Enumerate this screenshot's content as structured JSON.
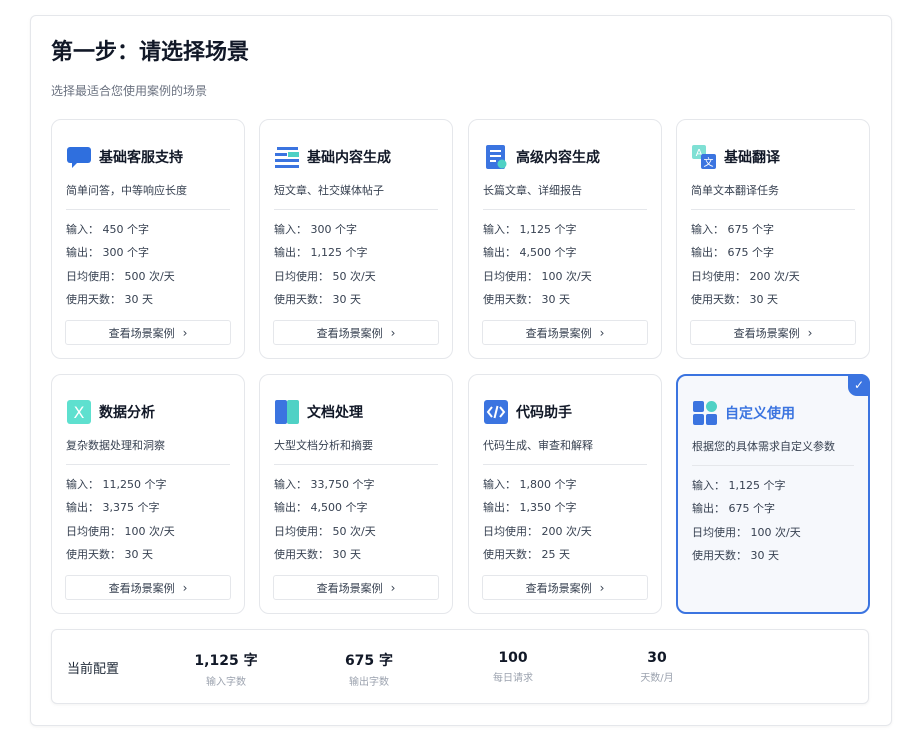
{
  "header": {
    "title": "第一步：请选择场景",
    "subtitle": "选择最适合您使用案例的场景"
  },
  "labels": {
    "input": "输入：",
    "output": "输出：",
    "daily": "日均使用：",
    "days": "使用天数：",
    "view_cases": "查看场景案例",
    "chevron": "›",
    "check": "✓"
  },
  "scenarios": [
    {
      "name": "基础客服支持",
      "icon": "chat-bubble-icon",
      "desc": "简单问答，中等响应长度",
      "input": "450 个字",
      "output": "300 个字",
      "daily": "500 次/天",
      "days": "30 天",
      "has_button": true,
      "selected": false
    },
    {
      "name": "基础内容生成",
      "icon": "text-lines-icon",
      "desc": "短文章、社交媒体帖子",
      "input": "300 个字",
      "output": "1,125 个字",
      "daily": "50 次/天",
      "days": "30 天",
      "has_button": true,
      "selected": false
    },
    {
      "name": "高级内容生成",
      "icon": "document-star-icon",
      "desc": "长篇文章、详细报告",
      "input": "1,125 个字",
      "output": "4,500 个字",
      "daily": "100 次/天",
      "days": "30 天",
      "has_button": true,
      "selected": false
    },
    {
      "name": "基础翻译",
      "icon": "translate-icon",
      "desc": "简单文本翻译任务",
      "input": "675 个字",
      "output": "675 个字",
      "daily": "200 次/天",
      "days": "30 天",
      "has_button": true,
      "selected": false
    },
    {
      "name": "数据分析",
      "icon": "excel-icon",
      "desc": "复杂数据处理和洞察",
      "input": "11,250 个字",
      "output": "3,375 个字",
      "daily": "100 次/天",
      "days": "30 天",
      "has_button": true,
      "selected": false
    },
    {
      "name": "文档处理",
      "icon": "book-icon",
      "desc": "大型文档分析和摘要",
      "input": "33,750 个字",
      "output": "4,500 个字",
      "daily": "50 次/天",
      "days": "30 天",
      "has_button": true,
      "selected": false
    },
    {
      "name": "代码助手",
      "icon": "code-icon",
      "desc": "代码生成、审查和解释",
      "input": "1,800 个字",
      "output": "1,350 个字",
      "daily": "200 次/天",
      "days": "25 天",
      "has_button": true,
      "selected": false
    },
    {
      "name": "自定义使用",
      "icon": "apps-grid-icon",
      "desc": "根据您的具体需求自定义参数",
      "input": "1,125 个字",
      "output": "675 个字",
      "daily": "100 次/天",
      "days": "30 天",
      "has_button": false,
      "selected": true
    }
  ],
  "config": {
    "label": "当前配置",
    "metrics": [
      {
        "value": "1,125 字",
        "label": "输入字数"
      },
      {
        "value": "675 字",
        "label": "输出字数"
      },
      {
        "value": "100",
        "label": "每日请求"
      },
      {
        "value": "30",
        "label": "天数/月"
      }
    ]
  },
  "colors": {
    "accent": "#3b74e0",
    "chat": "#2f6fde",
    "teal": "#4fd1c5",
    "excel_bg": "#5ee0cf"
  }
}
